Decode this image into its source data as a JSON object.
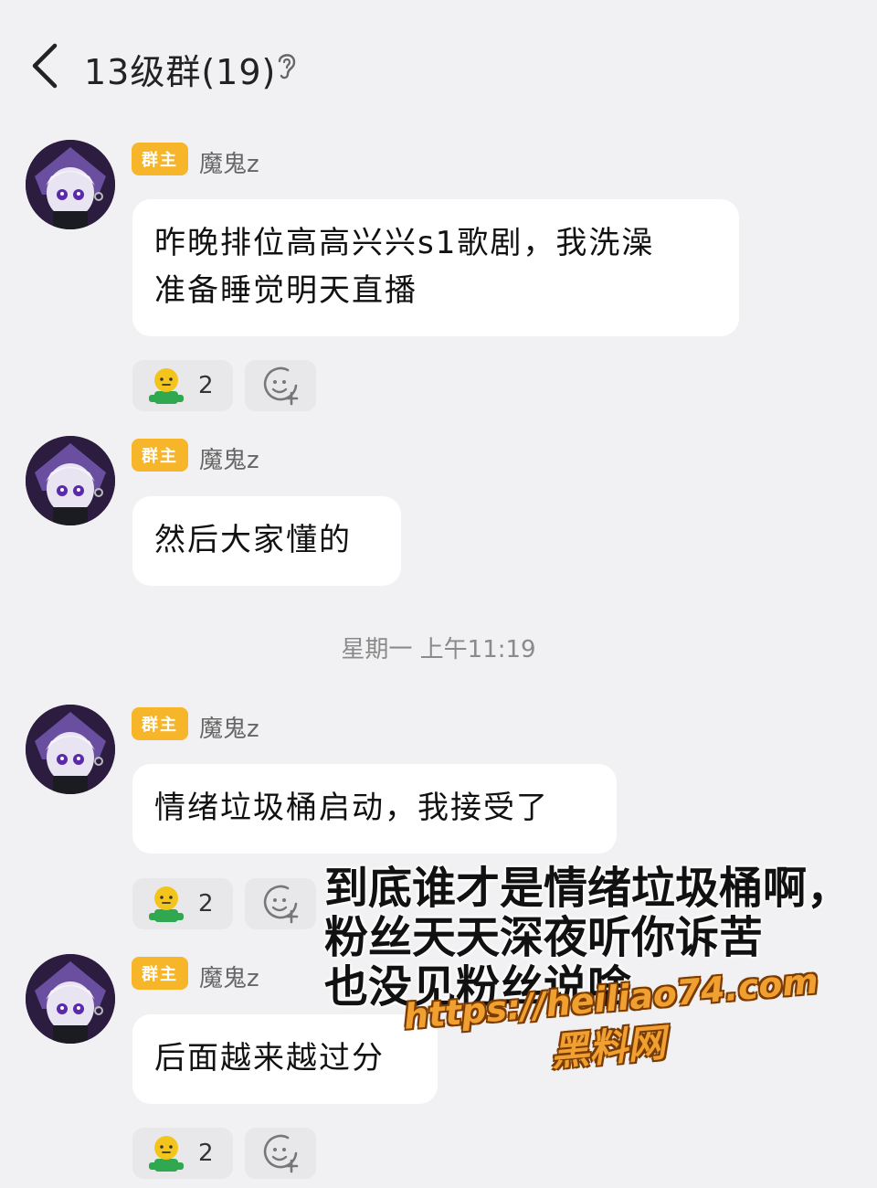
{
  "header": {
    "title": "13级群(19)"
  },
  "messages": [
    {
      "badge": "群主",
      "sender": "魔鬼z",
      "text_lines": [
        "昨晚排位高高兴兴s1歌剧，我洗澡",
        "准备睡觉明天直播"
      ],
      "reaction_count": "2"
    },
    {
      "badge": "群主",
      "sender": "魔鬼z",
      "text_lines": [
        "然后大家懂的"
      ]
    },
    {
      "badge": "群主",
      "sender": "魔鬼z",
      "text_lines": [
        "情绪垃圾桶启动，我接受了"
      ],
      "reaction_count": "2"
    },
    {
      "badge": "群主",
      "sender": "魔鬼z",
      "text_lines": [
        "后面越来越过分"
      ],
      "reaction_count": "2"
    }
  ],
  "timestamp": "星期一 上午11:19",
  "overlay_caption": "到底谁才是情绪垃圾桶啊，\n粉丝天天深夜听你诉苦\n也没见粉丝说啥",
  "watermark": {
    "url": "https://heiliao74.com",
    "name": "黑料网"
  },
  "colors": {
    "background": "#f1f1f3",
    "bubble": "#ffffff",
    "badge": "#f7b52a",
    "watermark": "#f0a030"
  },
  "icons": [
    "chevron-left-icon",
    "ear-icon",
    "avatar-image",
    "green-emoji-icon",
    "add-reaction-icon"
  ]
}
